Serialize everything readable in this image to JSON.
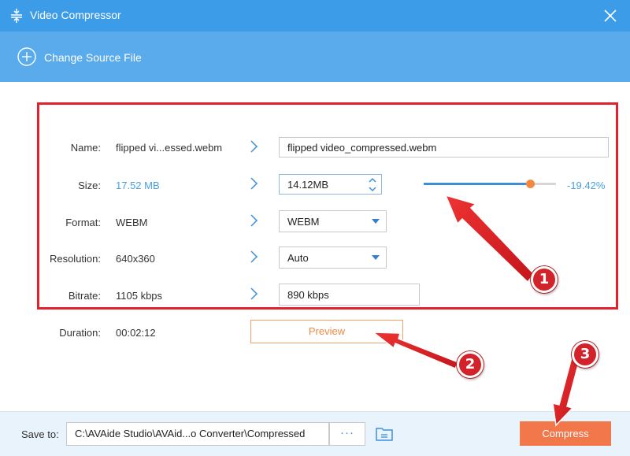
{
  "window": {
    "title": "Video Compressor",
    "close_icon": "close-icon"
  },
  "source": {
    "change_label": "Change Source File"
  },
  "rows": {
    "name": {
      "label": "Name:",
      "original": "flipped vi...essed.webm",
      "output": "flipped video_compressed.webm"
    },
    "size": {
      "label": "Size:",
      "original": "17.52 MB",
      "output": "14.12MB",
      "reduction": "-19.42%",
      "slider_fraction": 0.8058
    },
    "format": {
      "label": "Format:",
      "original": "WEBM",
      "output": "WEBM"
    },
    "resolution": {
      "label": "Resolution:",
      "original": "640x360",
      "output": "Auto"
    },
    "bitrate": {
      "label": "Bitrate:",
      "original": "1105 kbps",
      "output": "890 kbps"
    },
    "duration": {
      "label": "Duration:",
      "value": "00:02:12"
    }
  },
  "preview": {
    "label": "Preview"
  },
  "footer": {
    "save_label": "Save to:",
    "path": "C:\\AVAide Studio\\AVAid...o Converter\\Compressed",
    "browse_label": "···",
    "compress_label": "Compress"
  },
  "annotations": {
    "badge_1": "1",
    "badge_2": "2",
    "badge_3": "3"
  },
  "colors": {
    "titlebar": "#3d9ce8",
    "sourcebar": "#59abec",
    "accent_blue": "#4a9fe0",
    "accent_orange": "#f2784b",
    "annotation_red": "#e3202e"
  }
}
